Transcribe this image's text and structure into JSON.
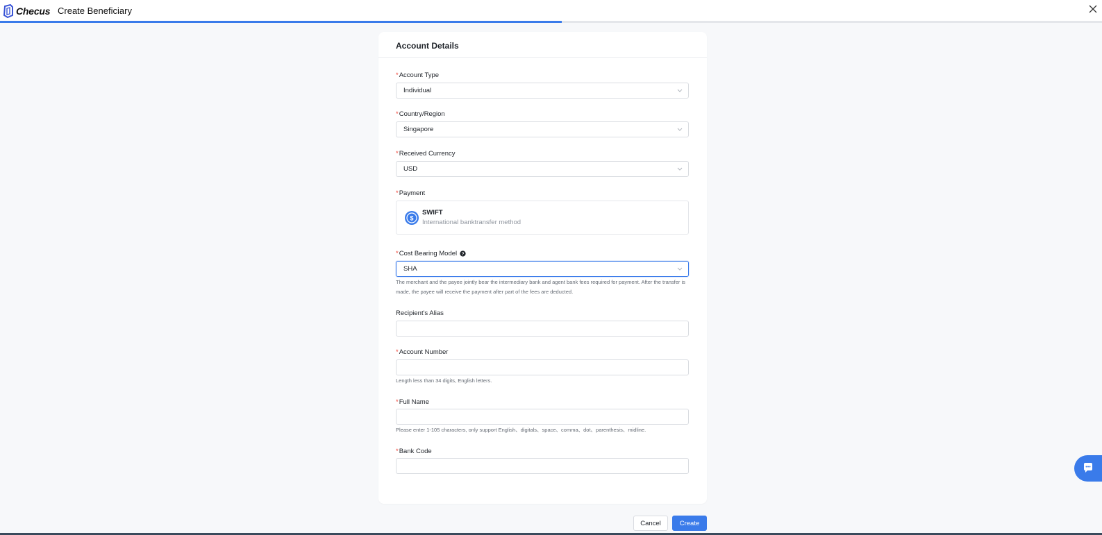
{
  "header": {
    "logo_text": "Checus",
    "title": "Create Beneficiary",
    "progress": 0.51
  },
  "card": {
    "title": "Account Details",
    "fields": {
      "account_type": {
        "label": "Account Type",
        "value": "Individual"
      },
      "country": {
        "label": "Country/Region",
        "value": "Singapore"
      },
      "currency": {
        "label": "Received Currency",
        "value": "USD"
      },
      "payment": {
        "label": "Payment",
        "method_title": "SWIFT",
        "method_desc": "International banktransfer method"
      },
      "cost_model": {
        "label": "Cost Bearing Model",
        "value": "SHA",
        "hint": "The merchant and the payee jointly bear the intermediary bank and agent bank fees required for payment. After the transfer is made, the payee will receive the payment after part of the fees are deducted."
      },
      "alias": {
        "label": "Recipient's Alias",
        "value": ""
      },
      "account_number": {
        "label": "Account Number",
        "value": "",
        "hint": "Length less than 34 digits, English letters."
      },
      "full_name": {
        "label": "Full Name",
        "value": "",
        "hint": "Please enter 1-105 characters, only support English、digitals、space、comma、dot、parenthesis、midline."
      },
      "bank_code": {
        "label": "Bank Code",
        "value": ""
      }
    },
    "required_mark": "*"
  },
  "actions": {
    "cancel": "Cancel",
    "create": "Create"
  },
  "colors": {
    "accent": "#3a7bea",
    "required": "#f04438"
  },
  "icons": [
    "checus-logo-icon",
    "close-icon",
    "chevron-down-icon",
    "dollar-icon",
    "help-icon",
    "chat-icon"
  ]
}
